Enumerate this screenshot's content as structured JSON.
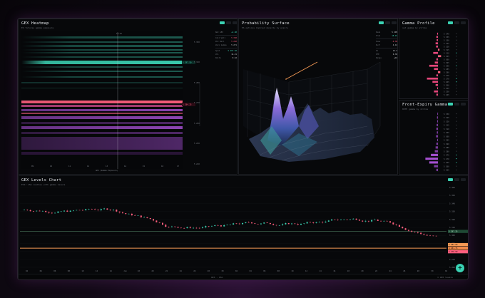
{
  "heatmap": {
    "title": "GEX Heatmap",
    "subtitle": "ES futures gamma exposure",
    "cursor_time": "14:32",
    "spot_label": "5 297.50",
    "level_label": "5 284.25",
    "price_axis": [
      "5 330",
      "5 310",
      "5 290",
      "5 270",
      "5 250",
      "5 230",
      "5 210"
    ],
    "time_axis": [
      "09",
      "10",
      "11",
      "12",
      "13",
      "14",
      "15",
      "16",
      "17"
    ],
    "bottom_label": "GEX (Gamma Exposure)",
    "side": [
      {
        "label": "Net GEX",
        "value": "+2.4B",
        "tone": "grn"
      },
      {
        "label": "Call Wall",
        "value": "5 330",
        "tone": "red"
      },
      {
        "label": "Put Wall",
        "value": "5 250",
        "tone": "red"
      },
      {
        "label": "Zero Gamma",
        "value": "5 271",
        "tone": ""
      },
      {
        "label": "Spot",
        "value": "5 297.50",
        "tone": "grn"
      },
      {
        "label": "Vol",
        "value": "14.21",
        "tone": ""
      },
      {
        "label": "Delta",
        "value": "0.42",
        "tone": ""
      }
    ]
  },
  "surface": {
    "title": "Probability Surface",
    "subtitle": "ES options implied density by expiry",
    "side": [
      {
        "label": "Peak",
        "value": "5 295",
        "tone": ""
      },
      {
        "label": "Prob",
        "value": "18.4%",
        "tone": "grn"
      },
      {
        "label": "Skew",
        "value": "-0.38",
        "tone": "red"
      },
      {
        "label": "Kurt",
        "value": "4.12",
        "tone": ""
      },
      {
        "label": "IV",
        "value": "14.2",
        "tone": ""
      },
      {
        "label": "DTE",
        "value": "0-30",
        "tone": ""
      },
      {
        "label": "Range",
        "value": "±42",
        "tone": ""
      }
    ]
  },
  "gamma_profile": {
    "title": "Gamma Profile",
    "subtitle": "net gamma by strike",
    "strikes": [
      "5 340",
      "5 335",
      "5 330",
      "5 325",
      "5 320",
      "5 315",
      "5 310",
      "5 305",
      "5 300",
      "5 295",
      "5 290",
      "5 285",
      "5 280",
      "5 275",
      "5 270",
      "5 265",
      "5 260",
      "5 255",
      "5 250",
      "5 245"
    ],
    "values": [
      0.05,
      0.1,
      0.08,
      0.15,
      0.12,
      -0.1,
      0.3,
      -0.2,
      0.1,
      0.2,
      0.55,
      0.25,
      -0.15,
      0.1,
      0.7,
      0.35,
      0.15,
      0.05,
      0.25,
      0.1
    ]
  },
  "front_expiry": {
    "title": "Front-Expiry Gamma",
    "subtitle": "0DTE gamma by strike",
    "strikes": [
      "5 330",
      "5 325",
      "5 320",
      "5 315",
      "5 310",
      "5 305",
      "5 300",
      "5 295",
      "5 290",
      "5 285",
      "5 280",
      "5 275",
      "5 270",
      "5 265",
      "5 260",
      "5 255"
    ],
    "values": [
      0.04,
      0.06,
      0.05,
      0.08,
      0.1,
      0.07,
      0.12,
      0.05,
      0.1,
      0.15,
      0.2,
      0.45,
      0.8,
      0.55,
      0.25,
      0.1
    ]
  },
  "levels_chart": {
    "title": "GEX Levels Chart",
    "subtitle": "ES1! 15m candles with gamma levels",
    "price_axis": [
      "5 360",
      "5 350",
      "5 340",
      "5 330",
      "5 320",
      "5 310",
      "5 300",
      "5 290",
      "5 280",
      "5 270",
      "5 260"
    ],
    "time_axis": [
      "02",
      "04",
      "06",
      "08",
      "10",
      "12",
      "14",
      "Jun",
      "18",
      "20",
      "22",
      "24",
      "26",
      "28",
      "30",
      "02",
      "04",
      "06",
      "08",
      "10",
      "12",
      "14",
      "16",
      "18",
      "20",
      "22",
      "24",
      "26",
      "28",
      "30",
      "02"
    ],
    "gamma_flip_tag": "5 297.25",
    "call_wall_tag": "5 284.00",
    "price_tag": "5 281.75",
    "red_tag": "5 276.50",
    "footer": "GEX · 15m",
    "footer_right": "© GEX levels"
  },
  "colors": {
    "accent": "#3cd3b4",
    "pink": "#ff5f7e",
    "purple": "#a44fd0",
    "orange": "#f59a55",
    "flip_line": "#6fb28a"
  }
}
